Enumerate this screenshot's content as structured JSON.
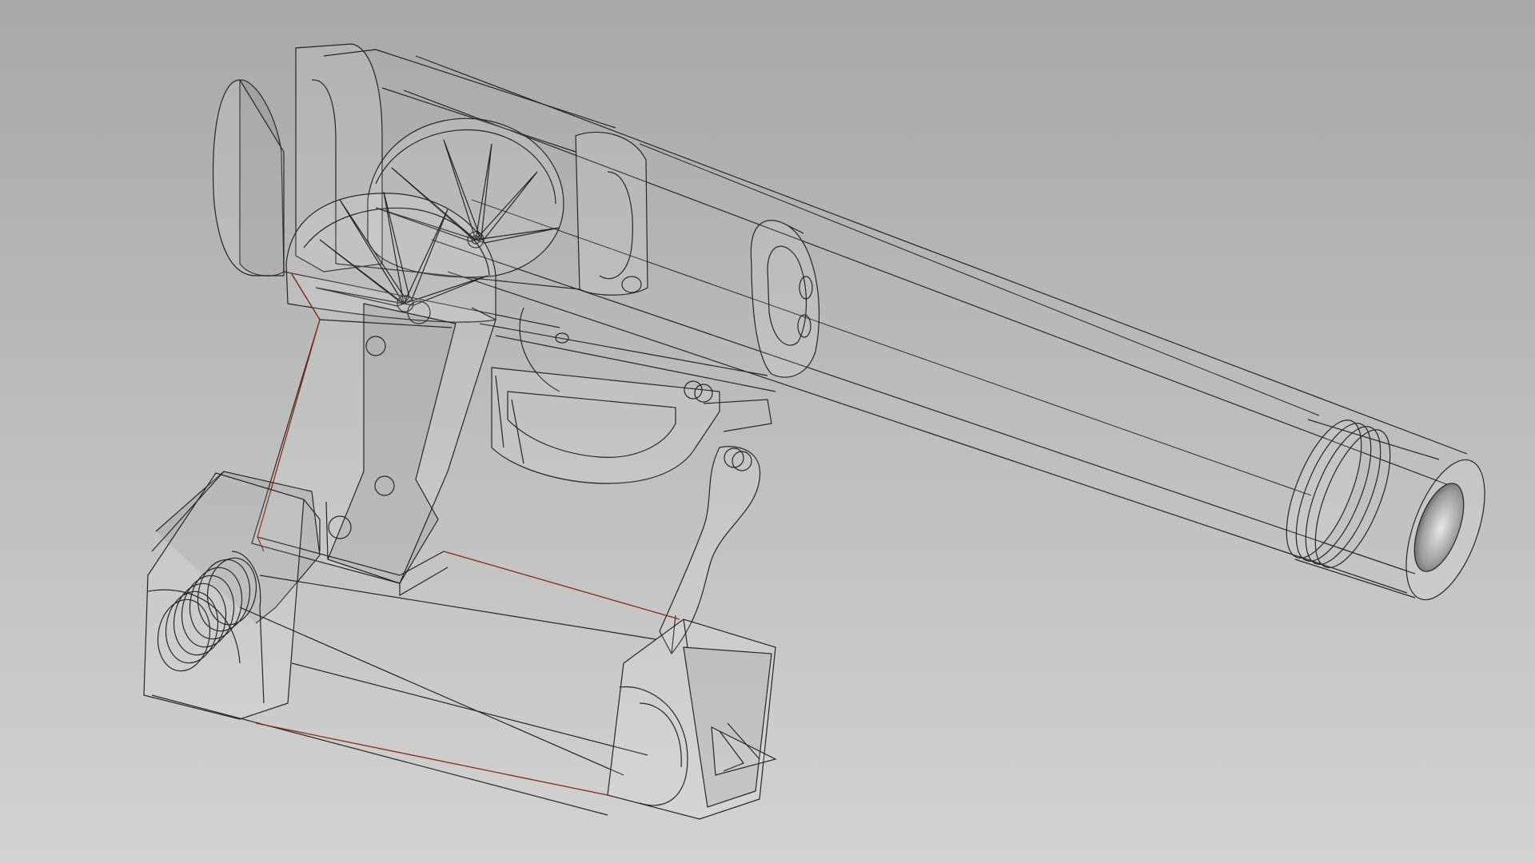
{
  "viewport": {
    "background_top": "#a8a8a8",
    "background_bottom": "#d2d2d2",
    "edge_color": "#262626",
    "highlight_color": "#8a2a10"
  },
  "model": {
    "parts": [
      "frame-body",
      "barrel",
      "muzzle",
      "rear-barrel-mount",
      "front-barrel-mount",
      "grip",
      "trigger-guard",
      "trigger",
      "flywheel-upper",
      "flywheel-lower",
      "magazine-tube",
      "spring-coil",
      "magazine-end-cap",
      "firing-pin"
    ]
  }
}
